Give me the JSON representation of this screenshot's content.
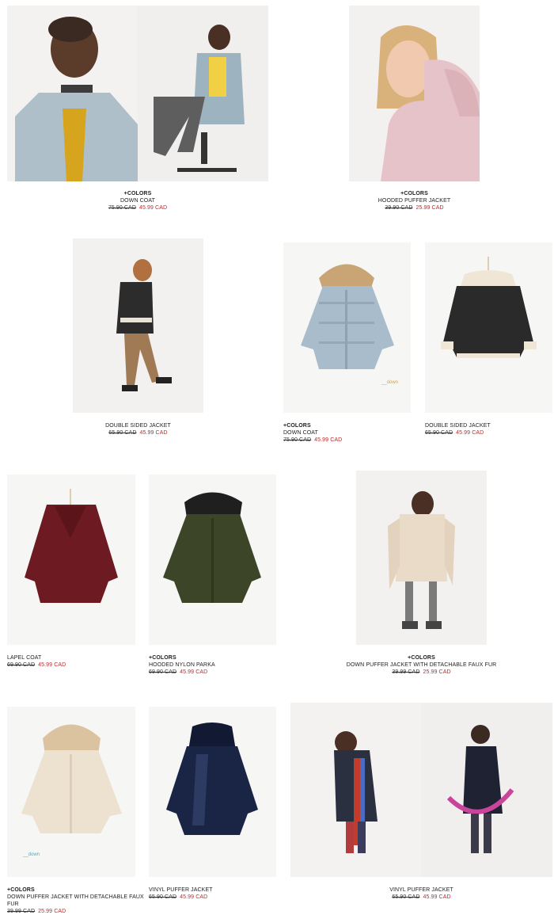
{
  "products": [
    {
      "id": "p1",
      "colors_label": "+COLORS",
      "name": "DOWN COAT",
      "old_price": "75.90 CAD",
      "new_price": "45.99 CAD",
      "image": "girl-seated-blue-down-coat"
    },
    {
      "id": "p2",
      "colors_label": "+COLORS",
      "name": "HOODED PUFFER JACKET",
      "old_price": "39.90 CAD",
      "new_price": "25.99 CAD",
      "image": "girl-pink-puffer-jacket"
    },
    {
      "id": "p3",
      "colors_label": "",
      "name": "DOUBLE SIDED JACKET",
      "old_price": "65.90 CAD",
      "new_price": "45.99 CAD",
      "image": "girl-walking-aviator-jacket"
    },
    {
      "id": "p4",
      "colors_label": "+COLORS",
      "name": "DOWN COAT",
      "old_price": "75.90 CAD",
      "new_price": "45.99 CAD",
      "image": "blue-down-coat-fur-hood",
      "tag": "__down"
    },
    {
      "id": "p5",
      "colors_label": "",
      "name": "DOUBLE SIDED JACKET",
      "old_price": "65.90 CAD",
      "new_price": "45.99 CAD",
      "image": "black-aviator-jacket"
    },
    {
      "id": "p6",
      "colors_label": "",
      "name": "LAPEL COAT",
      "old_price": "69.90 CAD",
      "new_price": "45.99 CAD",
      "image": "burgundy-lapel-coat"
    },
    {
      "id": "p7",
      "colors_label": "+COLORS",
      "name": "HOODED NYLON PARKA",
      "old_price": "69.90 CAD",
      "new_price": "45.99 CAD",
      "image": "khaki-parka-fur-hood"
    },
    {
      "id": "p8",
      "colors_label": "+COLORS",
      "name": "DOWN PUFFER JACKET WITH DETACHABLE FAUX FUR",
      "old_price": "39.99 CAD",
      "new_price": "25.99 CAD",
      "image": "girl-beige-puffer"
    },
    {
      "id": "p9",
      "colors_label": "+COLORS",
      "name": "DOWN PUFFER JACKET WITH DETACHABLE FAUX FUR",
      "old_price": "39.99 CAD",
      "new_price": "25.99 CAD",
      "image": "beige-puffer-fur-hood",
      "tag": "__down"
    },
    {
      "id": "p10",
      "colors_label": "",
      "name": "VINYL PUFFER JACKET",
      "old_price": "65.90 CAD",
      "new_price": "45.99 CAD",
      "image": "navy-vinyl-puffer"
    },
    {
      "id": "p11",
      "colors_label": "",
      "name": "VINYL PUFFER JACKET",
      "old_price": "65.90 CAD",
      "new_price": "45.99 CAD",
      "image": "boys-vinyl-puffer-scarves"
    }
  ]
}
